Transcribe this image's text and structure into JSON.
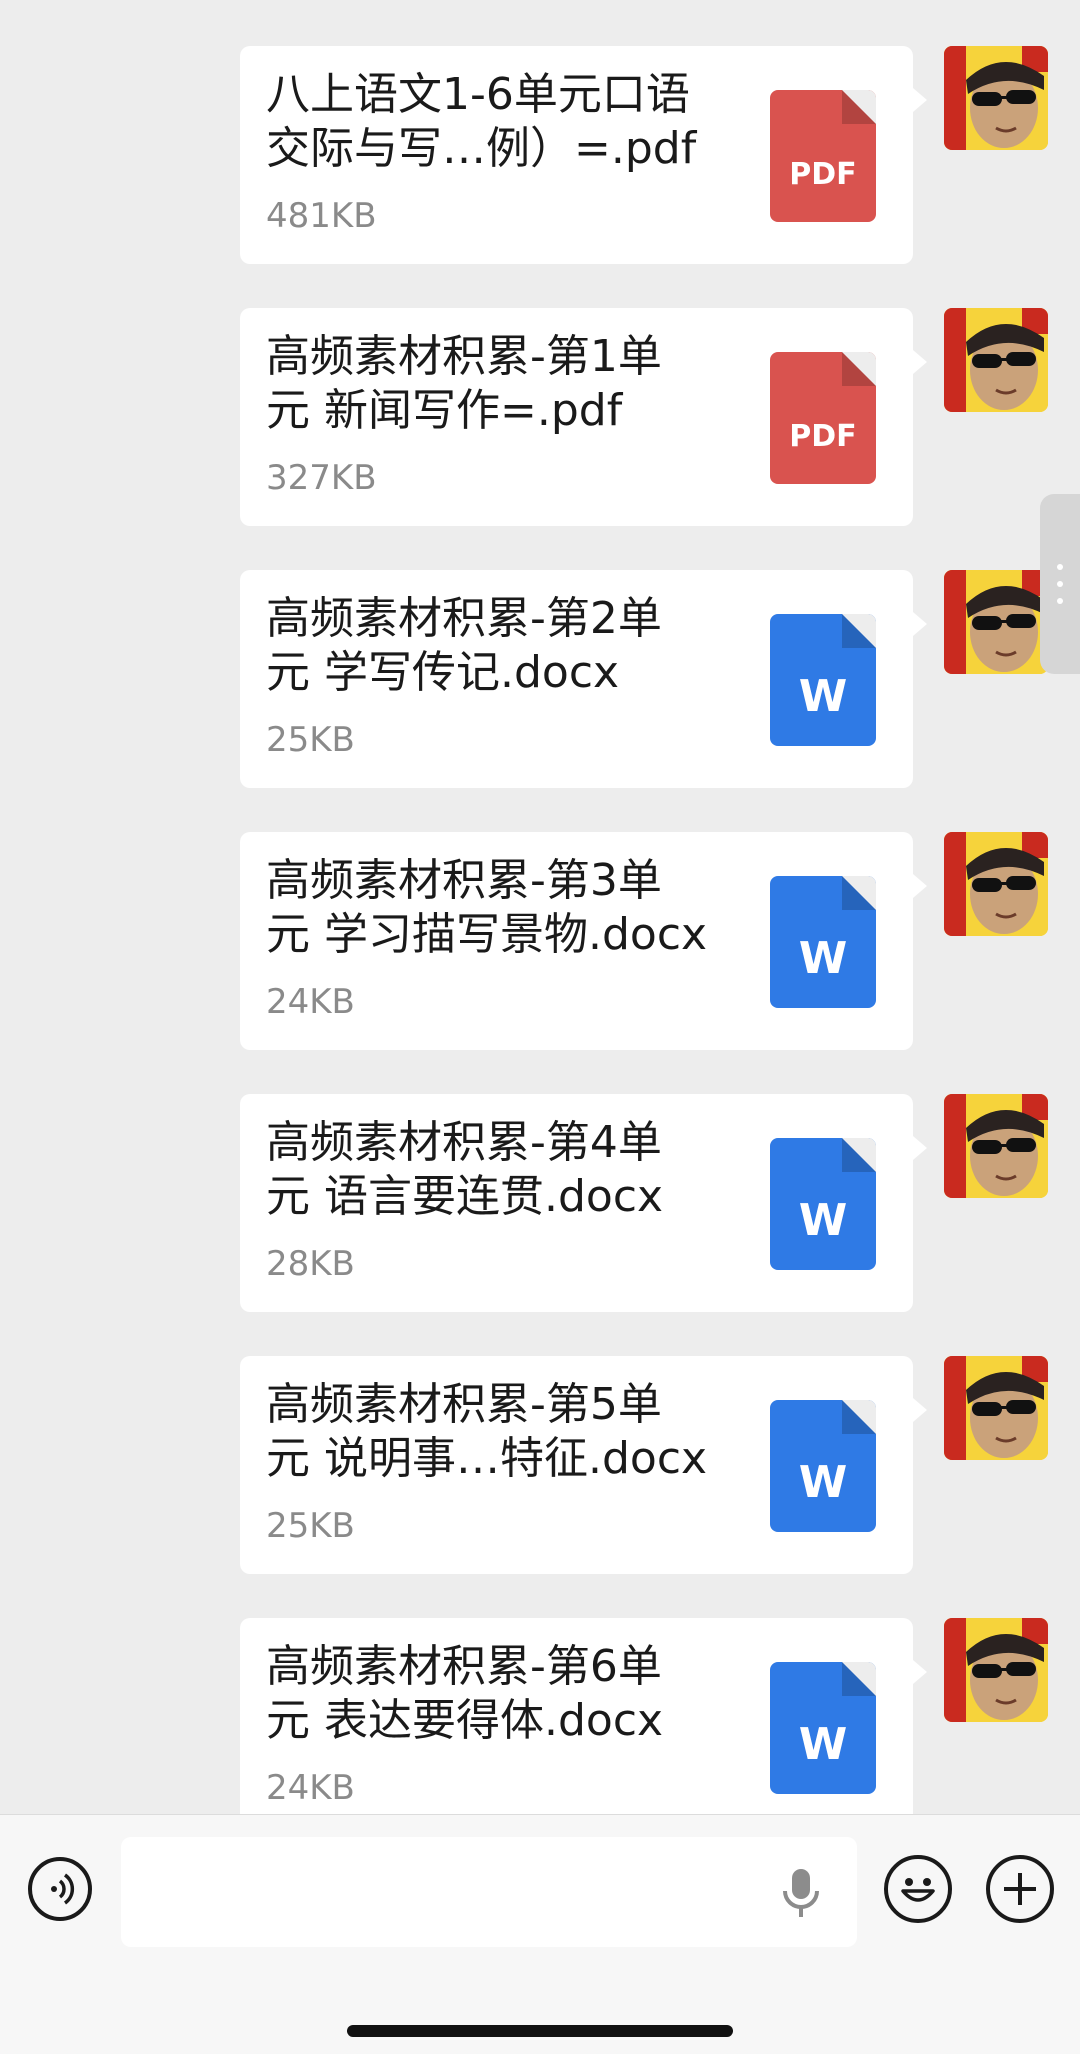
{
  "messages": [
    {
      "title": "八上语文1-6单元口语\n交际与写…例）=.pdf",
      "size": "481KB",
      "type": "pdf",
      "icon_label": "PDF",
      "icon_name": "pdf-file-icon"
    },
    {
      "title": "高频素材积累-第1单\n元 新闻写作=.pdf",
      "size": "327KB",
      "type": "pdf",
      "icon_label": "PDF",
      "icon_name": "pdf-file-icon"
    },
    {
      "title": "高频素材积累-第2单\n元 学写传记.docx",
      "size": "25KB",
      "type": "word",
      "icon_label": "W",
      "icon_name": "word-file-icon"
    },
    {
      "title": "高频素材积累-第3单\n元 学习描写景物.docx",
      "size": "24KB",
      "type": "word",
      "icon_label": "W",
      "icon_name": "word-file-icon"
    },
    {
      "title": "高频素材积累-第4单\n元 语言要连贯.docx",
      "size": "28KB",
      "type": "word",
      "icon_label": "W",
      "icon_name": "word-file-icon"
    },
    {
      "title": "高频素材积累-第5单\n元 说明事…特征.docx",
      "size": "25KB",
      "type": "word",
      "icon_label": "W",
      "icon_name": "word-file-icon"
    },
    {
      "title": "高频素材积累-第6单\n元 表达要得体.docx",
      "size": "24KB",
      "type": "word",
      "icon_label": "W",
      "icon_name": "word-file-icon"
    }
  ],
  "input_bar": {
    "input_value": "",
    "icons": [
      "voice-input-icon",
      "microphone-icon",
      "emoji-icon",
      "plus-icon"
    ]
  },
  "colors": {
    "background": "#ededed",
    "pdf": "#d9534f",
    "word": "#2f7ae5",
    "bubble": "#ffffff",
    "file_size_text": "#8a8a8a"
  }
}
